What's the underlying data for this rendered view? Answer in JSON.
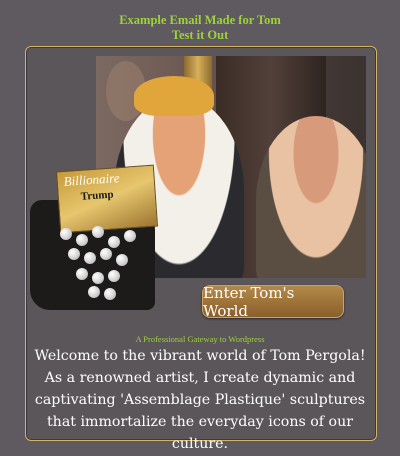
{
  "header": {
    "line1": "Example Email Made for Tom",
    "line2": "Test it Out"
  },
  "sculpture": {
    "magazine_title": "Billionaire",
    "magazine_subtitle": "Trump"
  },
  "cta": {
    "label": "Enter Tom's World"
  },
  "tagline": "A Professional Gateway to Wordpress",
  "body": {
    "text": "Welcome to the vibrant world of Tom Pergola! As a renowned artist, I create dynamic and captivating 'Assemblage Plastique' sculptures that immortalize the everyday icons of our culture."
  },
  "colors": {
    "background": "#5e5a5f",
    "accent_green": "#9ed23a",
    "border_gold": "#d4b463",
    "button_brown": "#8a5f2a"
  }
}
